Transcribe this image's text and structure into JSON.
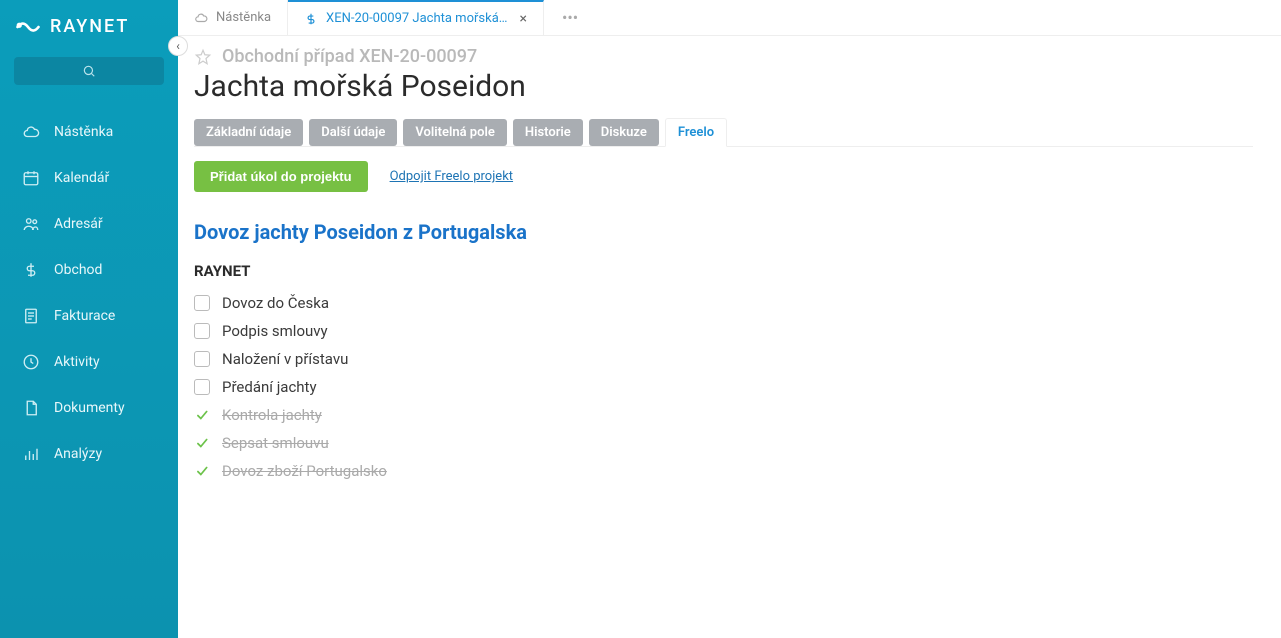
{
  "brand": {
    "name": "RAYNET"
  },
  "sidebar": {
    "items": [
      {
        "label": "Nástěnka"
      },
      {
        "label": "Kalendář"
      },
      {
        "label": "Adresář"
      },
      {
        "label": "Obchod"
      },
      {
        "label": "Fakturace"
      },
      {
        "label": "Aktivity"
      },
      {
        "label": "Dokumenty"
      },
      {
        "label": "Analýzy"
      }
    ]
  },
  "tabs": {
    "dashboard": "Nástěnka",
    "active": "XEN-20-00097 Jachta mořská…"
  },
  "header": {
    "breadcrumb": "Obchodní případ XEN-20-00097",
    "title": "Jachta mořská Poseidon"
  },
  "detail_tabs": [
    "Základní údaje",
    "Další údaje",
    "Volitelná pole",
    "Historie",
    "Diskuze",
    "Freelo"
  ],
  "actions": {
    "add_task": "Přidat úkol do projektu",
    "unlink": "Odpojit Freelo projekt"
  },
  "freelo": {
    "project_title": "Dovoz jachty Poseidon z Portugalska",
    "group": "RAYNET",
    "tasks": [
      {
        "label": "Dovoz do Česka",
        "done": false
      },
      {
        "label": "Podpis smlouvy",
        "done": false
      },
      {
        "label": "Naložení v přístavu",
        "done": false
      },
      {
        "label": "Předání jachty",
        "done": false
      },
      {
        "label": "Kontrola jachty",
        "done": true
      },
      {
        "label": "Sepsat smlouvu",
        "done": true
      },
      {
        "label": "Dovoz zboží Portugalsko",
        "done": true
      }
    ]
  }
}
